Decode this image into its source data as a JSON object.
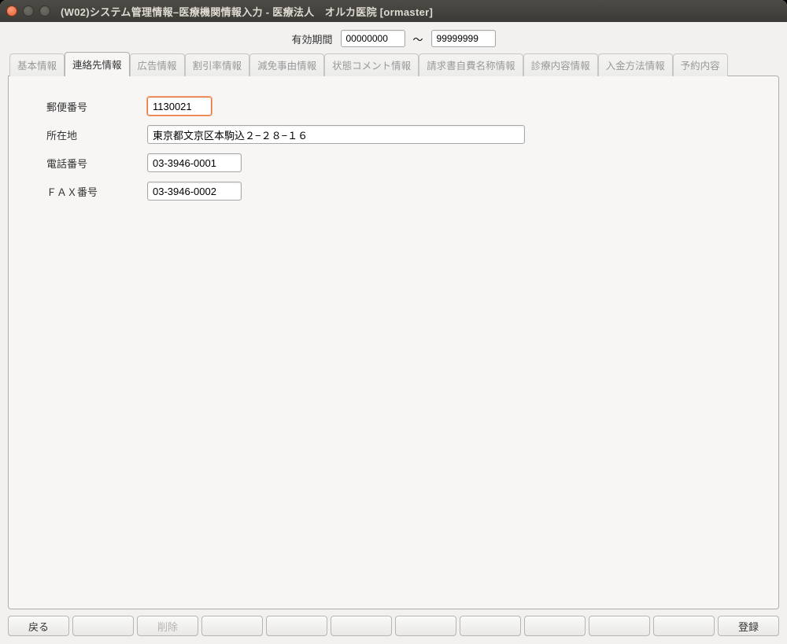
{
  "window_title": "(W02)システム管理情報–医療機関情報入力 - 医療法人　オルカ医院  [ormaster]",
  "validity": {
    "label": "有効期間",
    "from": "00000000",
    "to": "99999999",
    "sep": "～"
  },
  "tabs": [
    {
      "label": "基本情報"
    },
    {
      "label": "連絡先情報",
      "active": true
    },
    {
      "label": "広告情報"
    },
    {
      "label": "割引率情報"
    },
    {
      "label": "減免事由情報"
    },
    {
      "label": "状態コメント情報"
    },
    {
      "label": "請求書自費名称情報"
    },
    {
      "label": "診療内容情報"
    },
    {
      "label": "入金方法情報"
    },
    {
      "label": "予約内容"
    }
  ],
  "form": {
    "zip": {
      "label": "郵便番号",
      "value": "1130021"
    },
    "address": {
      "label": "所在地",
      "value": "東京都文京区本駒込２−２８−１６"
    },
    "tel": {
      "label": "電話番号",
      "value": "03-3946-0001"
    },
    "fax": {
      "label": "ＦＡＸ番号",
      "value": "03-3946-0002"
    }
  },
  "buttons": {
    "back": "戻る",
    "delete": "削除",
    "register": "登録"
  }
}
